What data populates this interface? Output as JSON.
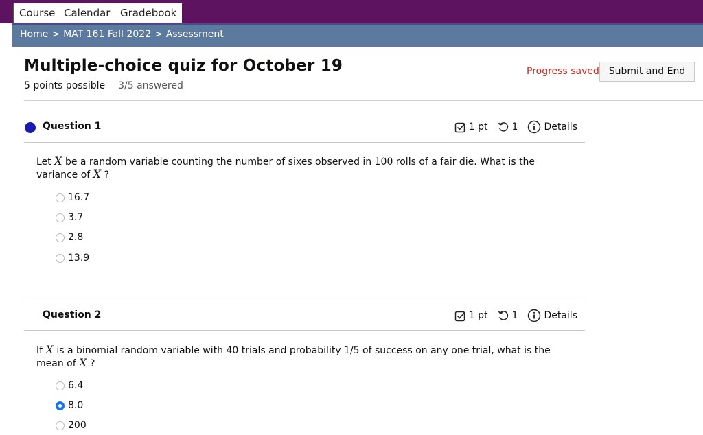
{
  "nav": {
    "items": [
      "Course",
      "Calendar",
      "Gradebook"
    ]
  },
  "breadcrumb": {
    "home": "Home",
    "sep": ">",
    "course": "MAT 161 Fall 2022",
    "current": "Assessment"
  },
  "quiz": {
    "title": "Multiple-choice quiz for October 19",
    "points_possible": "5 points possible",
    "answered": "3/5 answered",
    "progress_status": "Progress saved",
    "submit_label": "Submit and End"
  },
  "questions": [
    {
      "title": "Question 1",
      "points": "1 pt",
      "attempts": "1",
      "details_label": "Details",
      "text_parts": [
        "Let ",
        "X",
        " be a random variable counting the number of sixes observed in 100 rolls of a fair die. What is the variance of ",
        "X",
        " ?"
      ],
      "options": [
        "16.7",
        "3.7",
        "2.8",
        "13.9"
      ],
      "selected_index": null
    },
    {
      "title": "Question 2",
      "points": "1 pt",
      "attempts": "1",
      "details_label": "Details",
      "text_parts": [
        "If ",
        "X",
        " is a binomial random variable with 40 trials and probability 1/5 of success on any one trial, what is the mean of ",
        "X",
        " ?"
      ],
      "options": [
        "6.4",
        "8.0",
        "200"
      ],
      "selected_index": 1
    }
  ],
  "colors": {
    "nav_bg": "#5e1361",
    "breadcrumb_bg": "#5c7a9e",
    "progress_text": "#c8261e",
    "active_dot": "#1a1ab0",
    "radio_checked": "#1a73e8"
  }
}
